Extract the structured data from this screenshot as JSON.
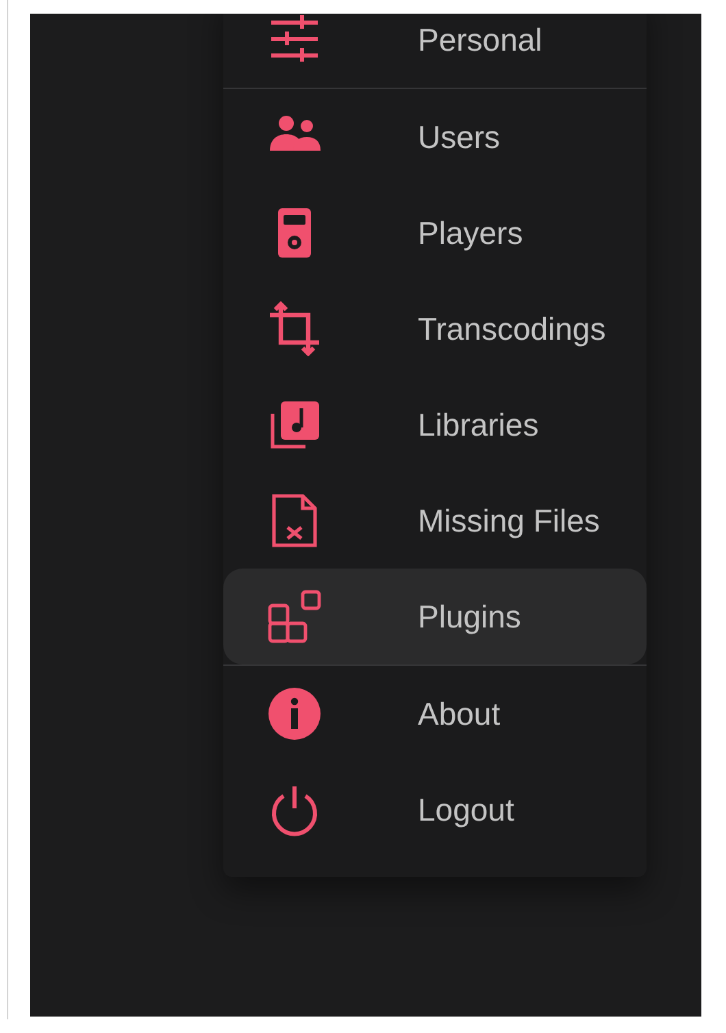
{
  "menu": {
    "sections": [
      [
        {
          "label": "Personal",
          "selected": false
        }
      ],
      [
        {
          "label": "Users",
          "selected": false
        },
        {
          "label": "Players",
          "selected": false
        },
        {
          "label": "Transcodings",
          "selected": false
        },
        {
          "label": "Libraries",
          "selected": false
        },
        {
          "label": "Missing Files",
          "selected": false
        },
        {
          "label": "Plugins",
          "selected": true
        }
      ],
      [
        {
          "label": "About",
          "selected": false
        },
        {
          "label": "Logout",
          "selected": false
        }
      ]
    ]
  }
}
